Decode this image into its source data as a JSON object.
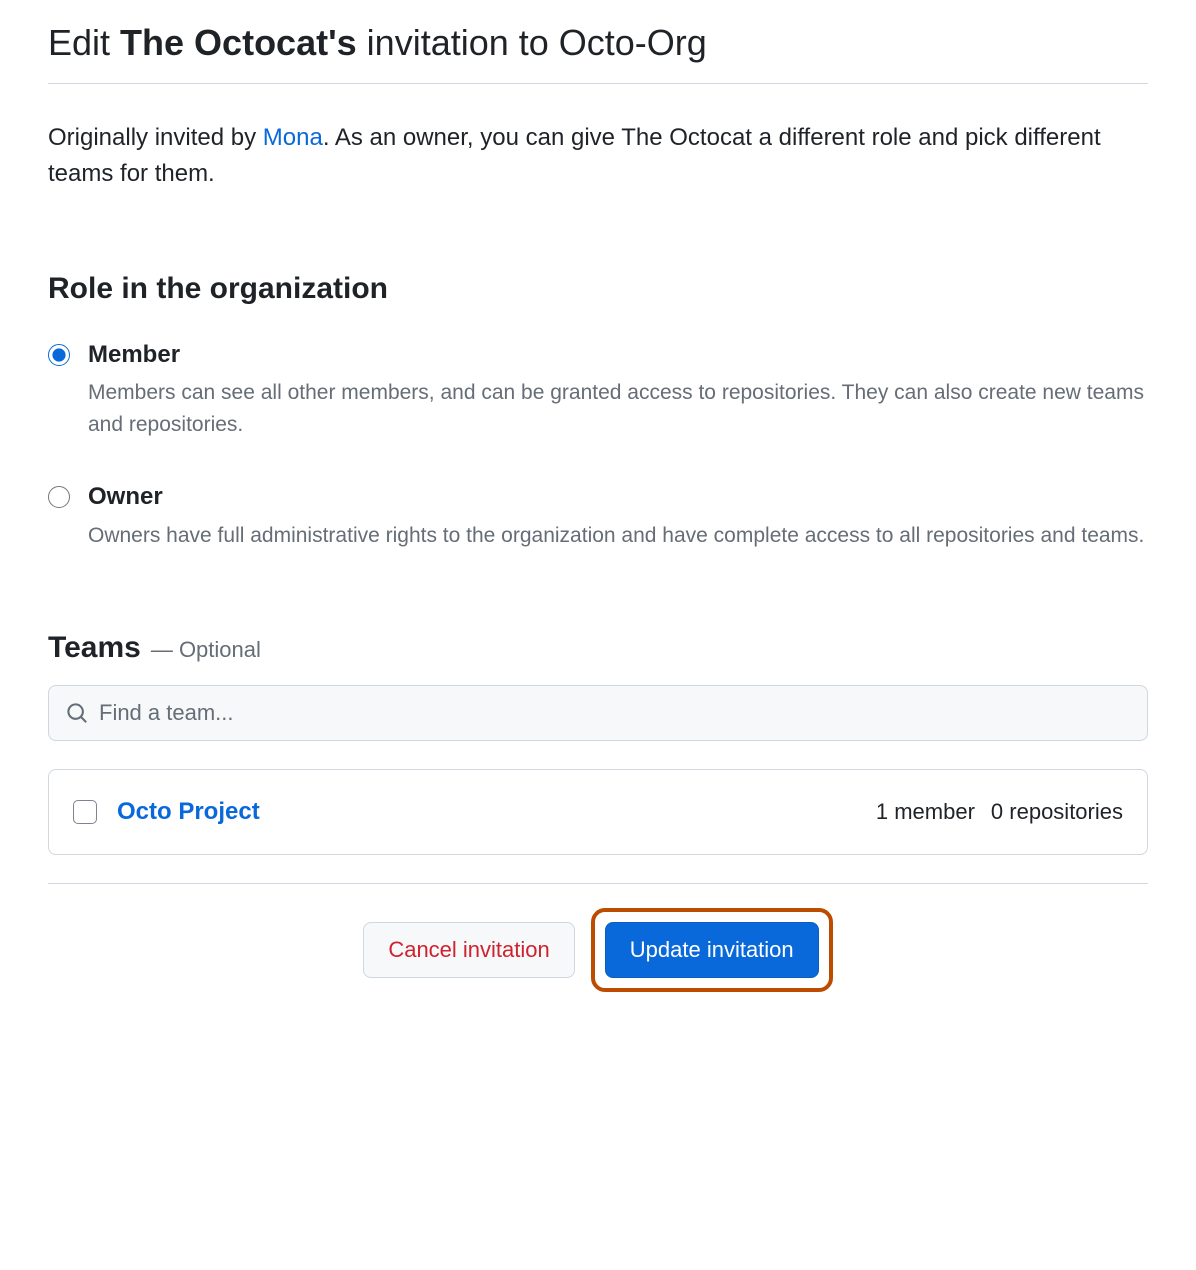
{
  "header": {
    "title_prefix": "Edit ",
    "title_bold": "The Octocat's",
    "title_suffix": " invitation to Octo-Org"
  },
  "description": {
    "text_before": "Originally invited by ",
    "inviter": "Mona",
    "text_after": ". As an owner, you can give The Octocat a different role and pick different teams for them."
  },
  "role_section": {
    "heading": "Role in the organization",
    "options": [
      {
        "label": "Member",
        "description": "Members can see all other members, and can be granted access to repositories. They can also create new teams and repositories.",
        "checked": true
      },
      {
        "label": "Owner",
        "description": "Owners have full administrative rights to the organization and have complete access to all repositories and teams.",
        "checked": false
      }
    ]
  },
  "teams_section": {
    "heading": "Teams",
    "optional_label": "— Optional",
    "search_placeholder": "Find a team...",
    "teams": [
      {
        "name": "Octo Project",
        "members": "1 member",
        "repositories": "0 repositories",
        "checked": false
      }
    ]
  },
  "footer": {
    "cancel_label": "Cancel invitation",
    "update_label": "Update invitation"
  }
}
